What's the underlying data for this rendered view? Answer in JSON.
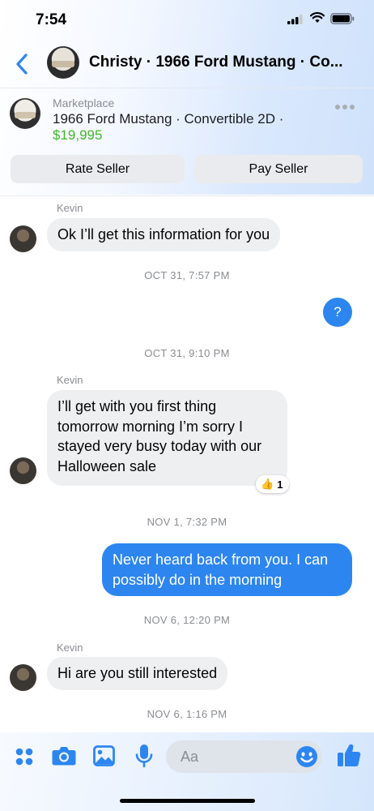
{
  "status": {
    "time": "7:54"
  },
  "header": {
    "title": "Christy · 1966 Ford Mustang · Co..."
  },
  "listing": {
    "label": "Marketplace",
    "name": "1966 Ford Mustang · Convertible 2D ·",
    "price": "$19,995",
    "rate_seller": "Rate Seller",
    "pay_seller": "Pay Seller"
  },
  "messages": {
    "m1": {
      "sender": "Kevin",
      "text": "Ok I’ll get this information for you"
    },
    "t1": "OCT 31, 7:57 PM",
    "m2": {
      "text": "?"
    },
    "t2": "OCT 31, 9:10 PM",
    "m3": {
      "sender": "Kevin",
      "text": "I’ll get with you first thing tomorrow morning I’m sorry I stayed very busy today with our Halloween sale",
      "reaction_count": "1"
    },
    "t3": "NOV 1, 7:32 PM",
    "m4": {
      "text": "Never heard back from you. I can possibly do in the morning"
    },
    "t4": "NOV 6, 12:20 PM",
    "m5": {
      "sender": "Kevin",
      "text": "Hi are you still interested"
    },
    "t5": "NOV 6, 1:16 PM"
  },
  "composer": {
    "placeholder": "Aa"
  },
  "colors": {
    "accent": "#2d86f0",
    "price_green": "#42b72a",
    "bubble_in": "#eeeff1"
  },
  "icons": [
    "back-chevron-icon",
    "more-dots-icon",
    "apps-grid-icon",
    "camera-icon",
    "photo-icon",
    "microphone-icon",
    "emoji-icon",
    "thumbs-up-icon"
  ]
}
